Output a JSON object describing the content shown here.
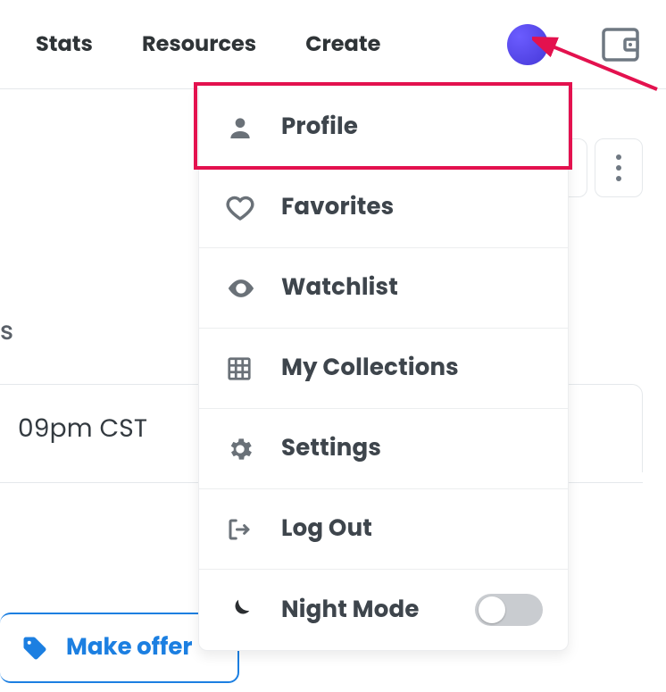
{
  "nav": {
    "links": [
      "Stats",
      "Resources",
      "Create"
    ]
  },
  "menu": {
    "items": [
      {
        "label": "Profile"
      },
      {
        "label": "Favorites"
      },
      {
        "label": "Watchlist"
      },
      {
        "label": "My Collections"
      },
      {
        "label": "Settings"
      },
      {
        "label": "Log Out"
      },
      {
        "label": "Night Mode"
      }
    ]
  },
  "page": {
    "truncated_letter": "s",
    "sale_time": "09pm CST",
    "offer_label": "Make offer"
  }
}
